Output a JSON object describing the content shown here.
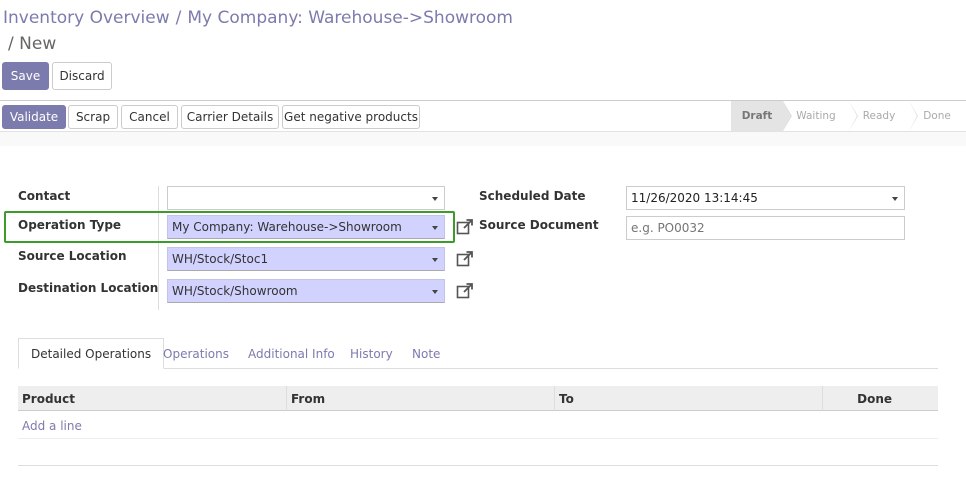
{
  "breadcrumb": {
    "item1": "Inventory Overview",
    "item2": "My Company: Warehouse->Showroom",
    "current": "New"
  },
  "buttons": {
    "save": "Save",
    "discard": "Discard",
    "validate": "Validate",
    "scrap": "Scrap",
    "cancel": "Cancel",
    "carrier": "Carrier Details",
    "negative": "Get negative products"
  },
  "status": {
    "steps": [
      "Draft",
      "Waiting",
      "Ready",
      "Done"
    ],
    "active": "Draft"
  },
  "form": {
    "contact": {
      "label": "Contact",
      "value": ""
    },
    "operation_type": {
      "label": "Operation Type",
      "value": "My Company: Warehouse->Showroom"
    },
    "source_location": {
      "label": "Source Location",
      "value": "WH/Stock/Stoc1"
    },
    "destination_location": {
      "label": "Destination Location",
      "value": "WH/Stock/Showroom"
    },
    "scheduled_date": {
      "label": "Scheduled Date",
      "value": "11/26/2020 13:14:45"
    },
    "source_document": {
      "label": "Source Document",
      "placeholder": "e.g. PO0032"
    }
  },
  "tabs": [
    "Detailed Operations",
    "Operations",
    "Additional Info",
    "History",
    "Note"
  ],
  "table": {
    "columns": [
      "Product",
      "From",
      "To",
      "Done"
    ],
    "add_line": "Add a line"
  },
  "colors": {
    "primary": "#7c7bad",
    "required_field": "#d2d2ff",
    "highlight": "#3d9a2c"
  }
}
